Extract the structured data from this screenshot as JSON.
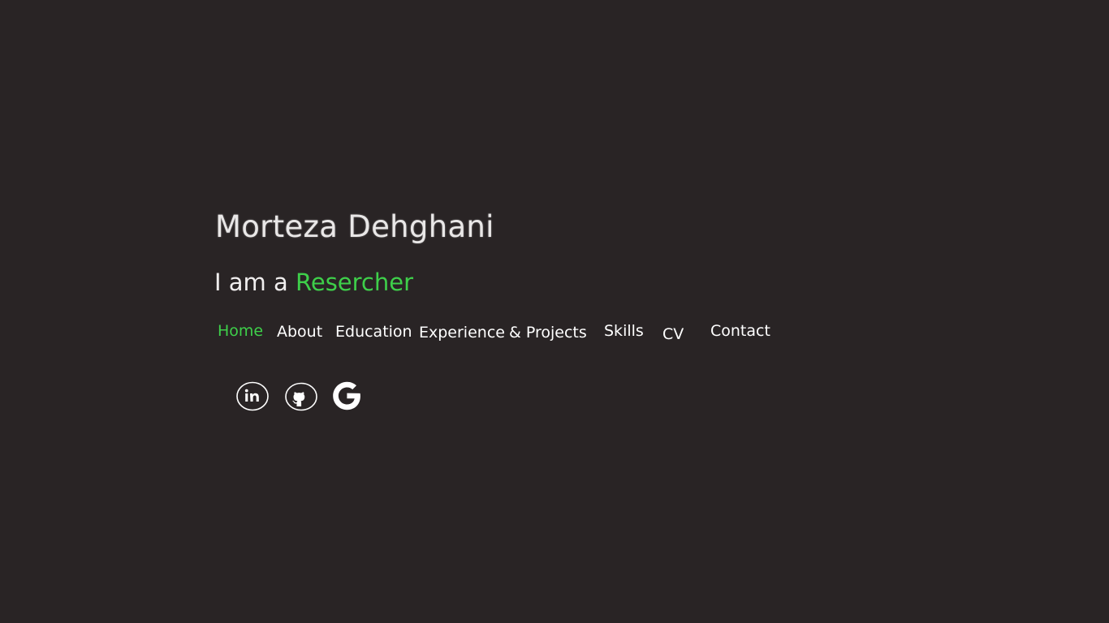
{
  "profile": {
    "name": "Morteza Dehghani",
    "tagline_prefix": "I am a",
    "tagline_role": "Resercher"
  },
  "nav": {
    "home": "Home",
    "about": "About",
    "education": "Education",
    "experience": "Experience",
    "projects": "& Projects",
    "skills": "Skills",
    "cv": "CV",
    "contact": "Contact"
  },
  "social": [
    {
      "icon": "linkedin-icon"
    },
    {
      "icon": "github-icon"
    },
    {
      "icon": "google-scholar-icon"
    }
  ],
  "colors": {
    "background": "#292425",
    "accent": "#3ecf4a",
    "text": "#ffffff"
  }
}
